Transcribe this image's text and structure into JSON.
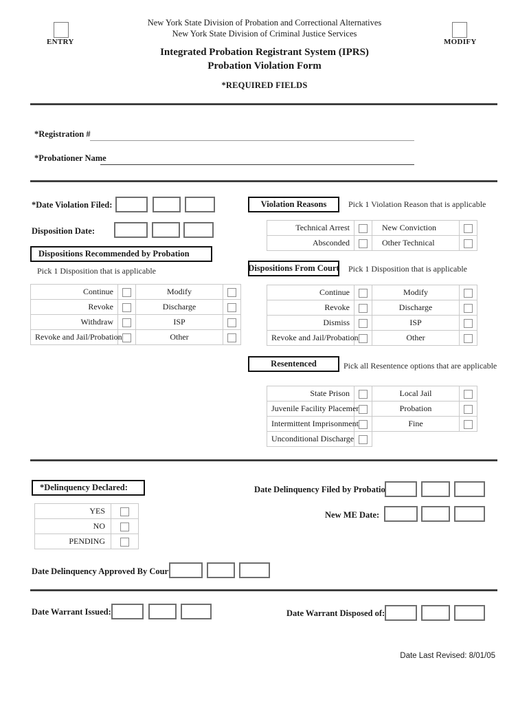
{
  "header": {
    "entry_label": "ENTRY",
    "modify_label": "MODIFY",
    "agency_line1": "New York State Division of Probation and Correctional Alternatives",
    "agency_line2": "New York State Division of Criminal Justice Services",
    "title_line1": "Integrated Probation Registrant System (IPRS)",
    "title_line2": "Probation Violation Form",
    "required_note": "*REQUIRED FIELDS"
  },
  "identity": {
    "registration_label": "*Registration #",
    "probationer_label": "*Probationer Name"
  },
  "dates": {
    "violation_filed_label": "*Date Violation Filed:",
    "disposition_date_label": "Disposition Date:",
    "delinquency_approved_label": "Date Delinquency Approved By Court:",
    "delinquency_filed_label": "Date Delinquency Filed by Probation:",
    "new_me_date_label": "New ME Date:",
    "warrant_issued_label": "Date Warrant Issued:",
    "warrant_disposed_label": "Date Warrant Disposed of:"
  },
  "violation_reasons": {
    "heading": "Violation Reasons",
    "hint": "Pick 1 Violation Reason that is applicable",
    "rows": [
      {
        "left": "Technical Arrest",
        "right": "New Conviction"
      },
      {
        "left": "Absconded",
        "right": "Other Technical"
      }
    ]
  },
  "dispositions_probation": {
    "heading": "Dispositions Recommended by Probation",
    "hint": "Pick 1 Disposition that is applicable",
    "rows": [
      {
        "left": "Continue",
        "right": "Modify"
      },
      {
        "left": "Revoke",
        "right": "Discharge"
      },
      {
        "left": "Withdraw",
        "right": "ISP"
      },
      {
        "left": "Revoke and Jail/Probation",
        "right": "Other"
      }
    ]
  },
  "dispositions_court": {
    "heading": "Dispositions From Court",
    "hint": "Pick 1 Disposition that is applicable",
    "rows": [
      {
        "left": "Continue",
        "right": "Modify"
      },
      {
        "left": "Revoke",
        "right": "Discharge"
      },
      {
        "left": "Dismiss",
        "right": "ISP"
      },
      {
        "left": "Revoke and Jail/Probation",
        "right": "Other"
      }
    ]
  },
  "resentenced": {
    "heading": "Resentenced",
    "hint": "Pick all Resentence options that are applicable",
    "rows": [
      {
        "left": "State Prison",
        "right": "Local Jail"
      },
      {
        "left": "Juvenile Facility Placement",
        "right": "Probation"
      },
      {
        "left": "Intermittent Imprisonment",
        "right": "Fine"
      },
      {
        "left": "Unconditional Discharge",
        "right": ""
      }
    ]
  },
  "delinquency": {
    "heading": "*Delinquency Declared:",
    "options": [
      "YES",
      "NO",
      "PENDING"
    ]
  },
  "footer": {
    "revised": "Date Last Revised: 8/01/05"
  }
}
